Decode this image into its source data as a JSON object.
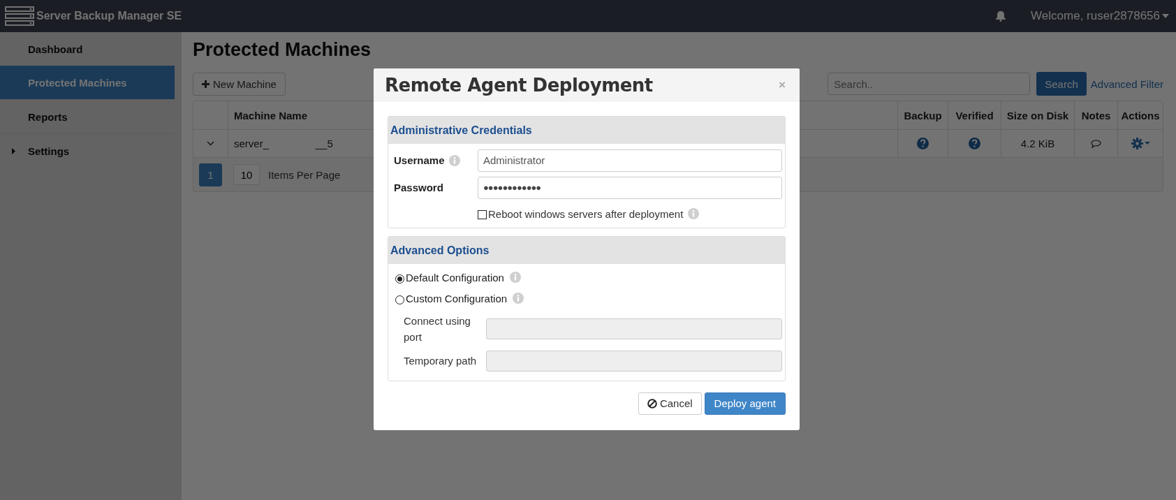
{
  "topbar": {
    "app_name": "Server Backup Manager SE",
    "user_menu": "Welcome, ruser2878656"
  },
  "sidebar": {
    "items": [
      {
        "label": "Dashboard",
        "selected": false,
        "expandable": false
      },
      {
        "label": "Protected Machines",
        "selected": true,
        "expandable": false
      },
      {
        "label": "Reports",
        "selected": false,
        "expandable": false
      },
      {
        "label": "Settings",
        "selected": false,
        "expandable": true
      }
    ]
  },
  "page": {
    "title": "Protected Machines",
    "new_button": "New Machine",
    "search": {
      "placeholder": "Search.."
    },
    "search_button": "Search",
    "advanced_filter": "Advanced Filter",
    "table": {
      "columns_left": [
        "Machine Name"
      ],
      "columns_right": [
        "Backup",
        "Verified",
        "Size on Disk",
        "Notes",
        "Actions"
      ],
      "rows": [
        {
          "name_parts": [
            "server_",
            "__5"
          ],
          "size_on_disk": "4.2 KiB"
        }
      ]
    },
    "pager": {
      "pages": [
        {
          "label": "1",
          "selected": true
        }
      ],
      "per_page": "10",
      "per_page_label": "Items Per Page"
    }
  },
  "modal": {
    "title": "Remote Agent Deployment",
    "close": "×",
    "credentials": {
      "heading": "Administrative Credentials",
      "fields": [
        {
          "label": "Username",
          "value": "Administrator",
          "info": true,
          "kind": "text"
        },
        {
          "label": "Password",
          "value": "●●●●●●●●●●●●",
          "info": false,
          "kind": "password"
        }
      ],
      "reboot": {
        "label": "Reboot windows servers after deployment",
        "checked": false
      }
    },
    "advanced": {
      "heading": "Advanced Options",
      "options": [
        {
          "label": "Default Configuration",
          "selected": true
        },
        {
          "label": "Custom Configuration",
          "selected": false
        }
      ],
      "fields": [
        {
          "label": "Connect using port",
          "disabled": true
        },
        {
          "label": "Temporary path",
          "disabled": true
        }
      ]
    },
    "buttons": [
      {
        "label": "Cancel",
        "kind": "secondary"
      },
      {
        "label": "Deploy agent",
        "kind": "primary"
      }
    ]
  }
}
